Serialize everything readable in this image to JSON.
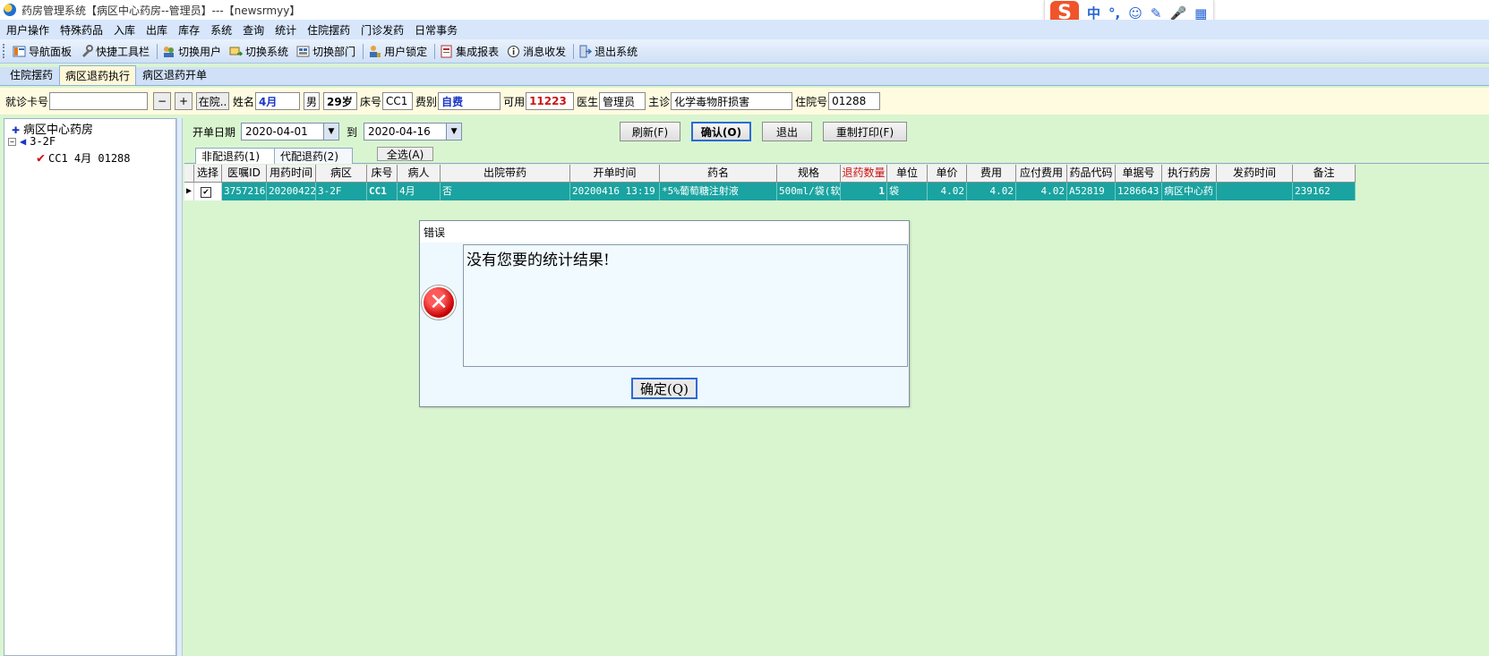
{
  "window": {
    "title": "药房管理系统【病区中心药房--管理员】---【newsrmyy】"
  },
  "ime": {
    "chinese_label": "中",
    "punct_label": "°,"
  },
  "menu": [
    "用户操作",
    "特殊药品",
    "入库",
    "出库",
    "库存",
    "系统",
    "查询",
    "统计",
    "住院摆药",
    "门诊发药",
    "日常事务"
  ],
  "toolbar": [
    {
      "label": "导航面板",
      "icon": "navigation-panel-icon"
    },
    {
      "label": "快捷工具栏",
      "icon": "quick-toolbar-icon"
    },
    {
      "label": "切换用户",
      "icon": "switch-user-icon"
    },
    {
      "label": "切换系统",
      "icon": "switch-system-icon"
    },
    {
      "label": "切换部门",
      "icon": "switch-department-icon"
    },
    {
      "label": "用户锁定",
      "icon": "user-lock-icon"
    },
    {
      "label": "集成报表",
      "icon": "report-icon"
    },
    {
      "label": "消息收发",
      "icon": "message-icon"
    },
    {
      "label": "退出系统",
      "icon": "exit-icon"
    }
  ],
  "tabs": [
    "住院摆药",
    "病区退药执行",
    "病区退药开单"
  ],
  "active_tab": "病区退药执行",
  "patient": {
    "card_label": "就诊卡号",
    "card_value": "",
    "minus": "−",
    "plus": "+",
    "status_button": "在院..",
    "name_label": "姓名",
    "name": "4月",
    "sex": "男",
    "age": "29岁",
    "bed_label": "床号",
    "bed": "CC1",
    "fee_type_label": "费别",
    "fee_type": "自费",
    "available_label": "可用",
    "available": "11223",
    "doctor_label": "医生",
    "doctor": "管理员",
    "diagnosis_label": "主诊",
    "diagnosis": "化学毒物肝损害",
    "inpatient_no_label": "住院号",
    "inpatient_no": "01288"
  },
  "tree": {
    "root": "病区中心药房",
    "ward": "3-2F",
    "patient": "CC1 4月 01288"
  },
  "date_filter": {
    "start_label": "开单日期",
    "start": "2020-04-01",
    "to_label": "到",
    "end": "2020-04-16"
  },
  "actions": {
    "refresh": "刷新(F)",
    "confirm": "确认(O)",
    "exit": "退出",
    "reprint": "重制打印(F)"
  },
  "subtabs": [
    "非配退药(1)",
    "代配退药(2)"
  ],
  "select_all": "全选(A)",
  "grid": {
    "columns": [
      "选择",
      "医嘱ID",
      "用药时间",
      "病区",
      "床号",
      "病人",
      "出院带药",
      "开单时间",
      "药名",
      "规格",
      "退药数量",
      "单位",
      "单价",
      "费用",
      "应付费用",
      "药品代码",
      "单据号",
      "执行药房",
      "发药时间",
      "备注"
    ],
    "highlight_column": "退药数量",
    "rows": [
      [
        "✔",
        "3757216",
        "20200422",
        "3-2F",
        "CC1",
        "4月",
        "否",
        "20200416 13:19",
        "*5%葡萄糖注射液",
        "500ml/袋(软",
        "1",
        "袋",
        "4.02",
        "4.02",
        "4.02",
        "A52819",
        "1286643",
        "病区中心药",
        "",
        "239162"
      ]
    ]
  },
  "dialog": {
    "title": "错误",
    "message": "没有您要的统计结果!",
    "ok": "确定(Q)"
  },
  "colors": {
    "app_bg": "#d9f5d0",
    "row_highlight": "#1aa3a0",
    "menu_bg": "#d7e6fb",
    "error_red": "#c50000"
  }
}
